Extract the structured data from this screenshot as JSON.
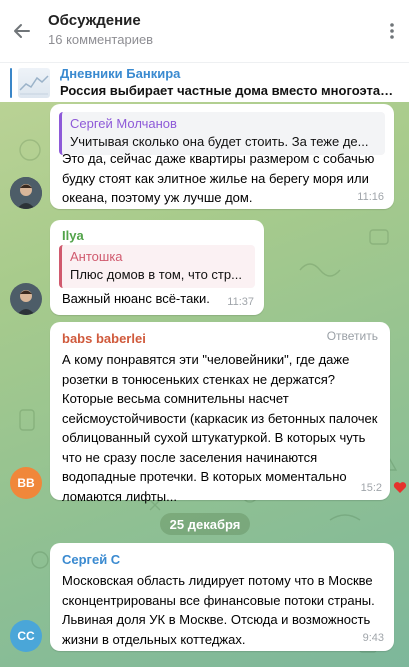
{
  "header": {
    "title": "Обсуждение",
    "subtitle": "16 комментариев"
  },
  "pinned": {
    "title": "Дневники Банкира",
    "text": "Россия выбирает частные дома вместо многоэтаж..."
  },
  "messages": [
    {
      "reply_to": {
        "name": "Сергей Молчанов",
        "text": "Учитывая сколько она будет стоить. За теже де..."
      },
      "text_lines": [
        "Это да, сейчас даже квартиры размером с собачью",
        "будку стоят как элитное жилье на берегу моря или",
        "океана, поэтому уж лучше дом."
      ],
      "time": "11:16"
    },
    {
      "sender": "Ilya",
      "reply_to": {
        "name": "Антошка",
        "text": "Плюс домов в том, что стр..."
      },
      "text_lines": [
        "Важный нюанс всё-таки."
      ],
      "time": "11:37"
    },
    {
      "sender": "babs baberlei",
      "action": "Ответить",
      "avatar_initials": "BB",
      "text_lines": [
        "А кому понравятся эти \"человейники\", где даже",
        "розетки в тонюсеньких стенках не держатся?",
        "Которые весьма сомнительны насчет",
        "сейсмоустойчивости (каркасик из бетонных палочек",
        "облицованный сухой штукатуркой. В которых чуть",
        "что не сразу после заселения начинаются",
        "водопадные протечки. В которых моментально",
        "ломаются лифты..."
      ],
      "time": "15:2"
    },
    {
      "sender": "Сергей С",
      "avatar_initials": "СС",
      "text_lines": [
        "Московская область лидирует потому что в Москве",
        "сконцентрированы все финансовые потоки страны.",
        "Львиная доля УК в Москве. Отсюда и возможность",
        "жизни в отдельных коттеджах."
      ],
      "time": "9:43"
    }
  ],
  "date_separator": "25 декабря",
  "colors": {
    "accent": "#3a8ad0",
    "sender_ilya": "#52a34a",
    "sender_babs": "#d05a3c",
    "sender_sergey": "#3a8ad0",
    "reply_molchanov": "#8e5ad8",
    "reply_antoshka": "#d05a6e",
    "avatar_bb": "#f0873a",
    "avatar_ss": "#4aa6d8"
  },
  "icons": {
    "back": "arrow-left-icon",
    "menu": "more-vertical-icon",
    "reaction": "heart-icon"
  }
}
